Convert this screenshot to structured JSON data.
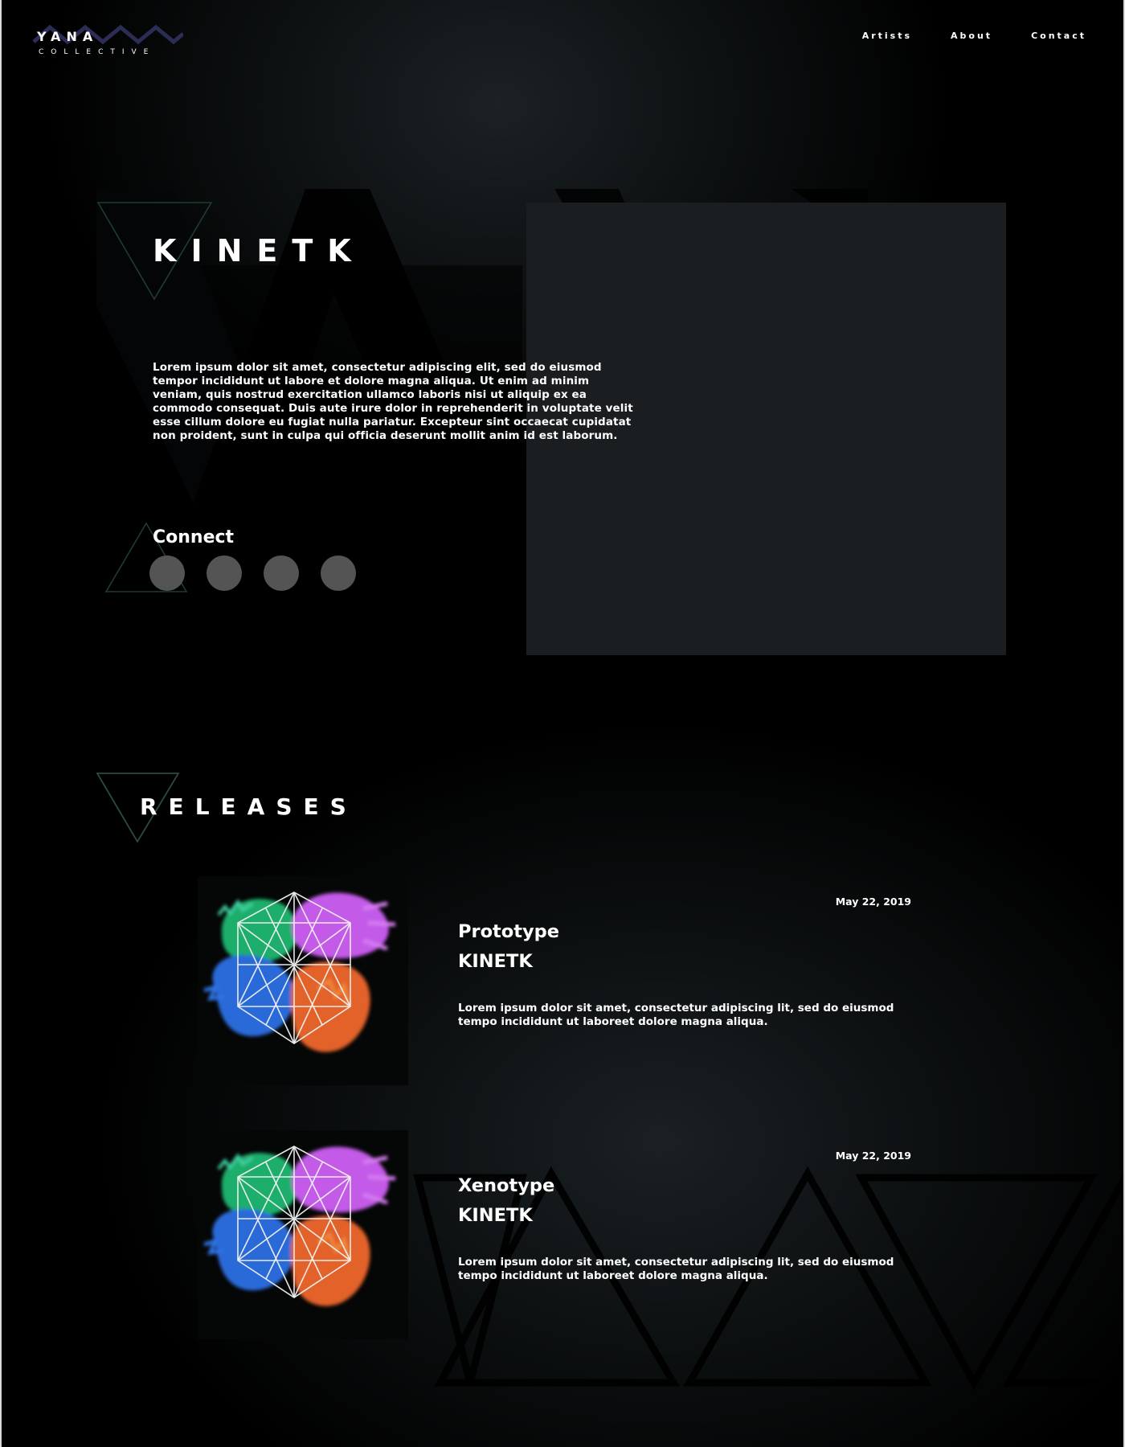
{
  "header": {
    "logo_word": "YANA",
    "logo_sub": "COLLECTIVE",
    "nav": [
      {
        "label": "Artists"
      },
      {
        "label": "About"
      },
      {
        "label": "Contact"
      }
    ]
  },
  "hero": {
    "title": "KINETK",
    "bio": "Lorem ipsum dolor sit amet, consectetur adipiscing elit, sed do eiusmod tempor incididunt ut labore et dolore magna aliqua. Ut enim ad minim veniam, quis nostrud exercitation ullamco laboris nisi ut aliquip ex ea commodo consequat. Duis aute irure dolor in reprehenderit in voluptate velit esse cillum dolore eu fugiat nulla pariatur.  Excepteur sint occaecat cupidatat non proident, sunt in culpa qui officia deserunt mollit anim id est laborum.",
    "connect_label": "Connect",
    "social_count": 4
  },
  "releases": {
    "title": "RELEASES",
    "items": [
      {
        "date": "May 22, 2019",
        "name": "Prototype",
        "artist": "KINETK",
        "description": "Lorem ipsum dolor sit amet, consectetur adipiscing lit, sed do eiusmod tempo incididunt ut laboreet dolore magna aliqua.",
        "art_icon": "cube-artwork-icon"
      },
      {
        "date": "May 22, 2019",
        "name": "Xenotype",
        "artist": "KINETK",
        "description": "Lorem ipsum dolor sit amet, consectetur adipiscing lit, sed do eiusmod tempo incididunt ut laboreet dolore magna aliqua.",
        "art_icon": "cube-artwork-icon"
      }
    ]
  },
  "colors": {
    "background": "#000000",
    "panel": "#1a1e21",
    "social_dot": "#545454",
    "accent_logo": "#2b2d55",
    "triangle_outline": "#1f3b33"
  }
}
